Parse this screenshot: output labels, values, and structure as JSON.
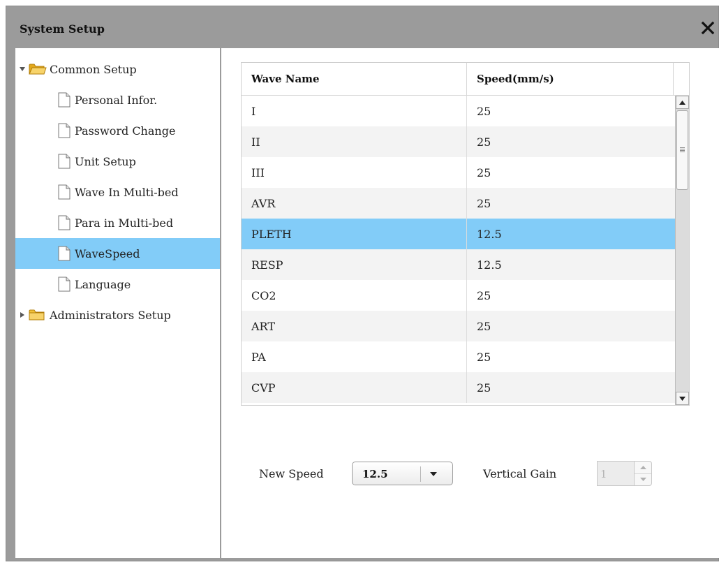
{
  "dialog": {
    "title": "System Setup",
    "close_icon": "close-icon"
  },
  "tree": {
    "groups": [
      {
        "label": "Common Setup",
        "expanded": true,
        "items": [
          {
            "label": "Personal Infor."
          },
          {
            "label": "Password Change"
          },
          {
            "label": "Unit Setup"
          },
          {
            "label": "Wave In Multi-bed"
          },
          {
            "label": "Para in Multi-bed"
          },
          {
            "label": "WaveSpeed",
            "selected": true
          },
          {
            "label": "Language"
          }
        ]
      },
      {
        "label": "Administrators Setup",
        "expanded": false,
        "items": []
      }
    ]
  },
  "table": {
    "headers": [
      "Wave Name",
      "Speed(mm/s)"
    ],
    "rows": [
      {
        "name": "I",
        "speed": "25"
      },
      {
        "name": "II",
        "speed": "25"
      },
      {
        "name": "III",
        "speed": "25"
      },
      {
        "name": "AVR",
        "speed": "25"
      },
      {
        "name": "PLETH",
        "speed": "12.5",
        "selected": true
      },
      {
        "name": "RESP",
        "speed": "12.5"
      },
      {
        "name": "CO2",
        "speed": "25"
      },
      {
        "name": "ART",
        "speed": "25"
      },
      {
        "name": "PA",
        "speed": "25"
      },
      {
        "name": "CVP",
        "speed": "25"
      }
    ]
  },
  "controls": {
    "new_speed_label": "New Speed",
    "new_speed_value": "12.5",
    "vertical_gain_label": "Vertical Gain",
    "vertical_gain_value": "1",
    "vertical_gain_disabled": true
  },
  "colors": {
    "selection": "#82ccf8",
    "dialog_frame": "#9b9b9b"
  }
}
